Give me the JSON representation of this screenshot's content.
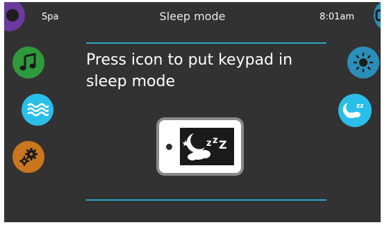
{
  "header": {
    "app_label": "Spa",
    "title": "Sleep mode",
    "time": "8:01am"
  },
  "main": {
    "prompt": "Press icon to put keypad in sleep mode"
  },
  "colors": {
    "background": "#323232",
    "accent_line": "#2aa9c6",
    "purple": "#6a3a9e",
    "green": "#2f9a3b",
    "cyan": "#29bfe8",
    "orange": "#c9761e",
    "blue_right": "#2a8fb8"
  },
  "icons": {
    "left_nav": [
      "profile-icon",
      "music-icon",
      "water-icon",
      "settings-icon"
    ],
    "right_nav": [
      "screen-icon",
      "brightness-icon",
      "sleep-icon"
    ],
    "center": "keypad-sleep-icon"
  }
}
